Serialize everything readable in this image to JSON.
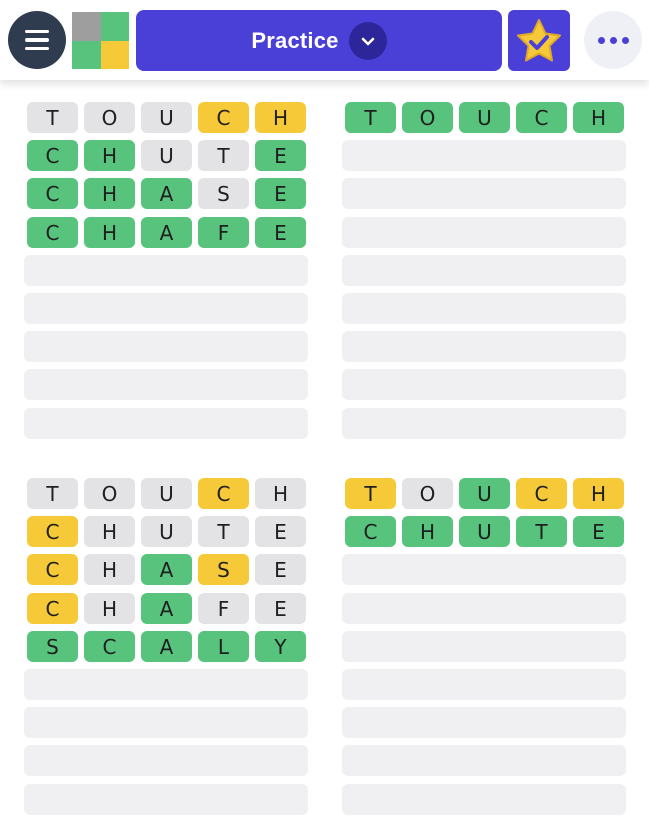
{
  "header": {
    "mode_label": "Practice",
    "icons": {
      "menu": "hamburger-icon",
      "logo": "app-logo",
      "chevron": "chevron-down-icon",
      "stats": "star-check-icon",
      "more": "more-horizontal-icon"
    },
    "colors": {
      "primary": "#4a40d8",
      "menu_bg": "#2f3c4f",
      "logo": [
        "#9e9e9e",
        "#57c37d",
        "#57c37d",
        "#f5c938"
      ]
    }
  },
  "colors": {
    "gray": "#e3e3e6",
    "yellow": "#f5c938",
    "green": "#57c37d",
    "empty": "#f0f0f2"
  },
  "boards": [
    {
      "rows": 9,
      "guesses": [
        {
          "letters": [
            "T",
            "O",
            "U",
            "C",
            "H"
          ],
          "states": [
            "gray",
            "gray",
            "gray",
            "yellow",
            "yellow"
          ]
        },
        {
          "letters": [
            "C",
            "H",
            "U",
            "T",
            "E"
          ],
          "states": [
            "green",
            "green",
            "gray",
            "gray",
            "green"
          ]
        },
        {
          "letters": [
            "C",
            "H",
            "A",
            "S",
            "E"
          ],
          "states": [
            "green",
            "green",
            "green",
            "gray",
            "green"
          ]
        },
        {
          "letters": [
            "C",
            "H",
            "A",
            "F",
            "E"
          ],
          "states": [
            "green",
            "green",
            "green",
            "green",
            "green"
          ]
        }
      ]
    },
    {
      "rows": 9,
      "guesses": [
        {
          "letters": [
            "T",
            "O",
            "U",
            "C",
            "H"
          ],
          "states": [
            "green",
            "green",
            "green",
            "green",
            "green"
          ]
        }
      ]
    },
    {
      "rows": 9,
      "guesses": [
        {
          "letters": [
            "T",
            "O",
            "U",
            "C",
            "H"
          ],
          "states": [
            "gray",
            "gray",
            "gray",
            "yellow",
            "gray"
          ]
        },
        {
          "letters": [
            "C",
            "H",
            "U",
            "T",
            "E"
          ],
          "states": [
            "yellow",
            "gray",
            "gray",
            "gray",
            "gray"
          ]
        },
        {
          "letters": [
            "C",
            "H",
            "A",
            "S",
            "E"
          ],
          "states": [
            "yellow",
            "gray",
            "green",
            "yellow",
            "gray"
          ]
        },
        {
          "letters": [
            "C",
            "H",
            "A",
            "F",
            "E"
          ],
          "states": [
            "yellow",
            "gray",
            "green",
            "gray",
            "gray"
          ]
        },
        {
          "letters": [
            "S",
            "C",
            "A",
            "L",
            "Y"
          ],
          "states": [
            "green",
            "green",
            "green",
            "green",
            "green"
          ]
        }
      ]
    },
    {
      "rows": 9,
      "guesses": [
        {
          "letters": [
            "T",
            "O",
            "U",
            "C",
            "H"
          ],
          "states": [
            "yellow",
            "gray",
            "green",
            "yellow",
            "yellow"
          ]
        },
        {
          "letters": [
            "C",
            "H",
            "U",
            "T",
            "E"
          ],
          "states": [
            "green",
            "green",
            "green",
            "green",
            "green"
          ]
        }
      ]
    }
  ]
}
